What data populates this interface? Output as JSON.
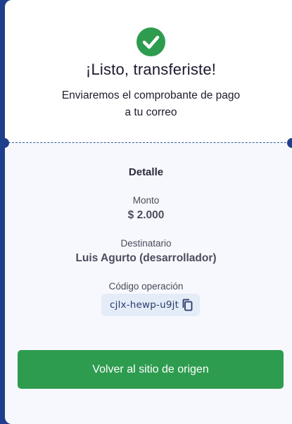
{
  "status": {
    "icon": "check-circle-icon",
    "title": "¡Listo, transferiste!",
    "subtitle_line1": "Enviaremos el comprobante de pago",
    "subtitle_line2": "a tu correo"
  },
  "details": {
    "section_title": "Detalle",
    "amount_label": "Monto",
    "amount_value": "$ 2.000",
    "recipient_label": "Destinatario",
    "recipient_value": "Luis Agurto (desarrollador)",
    "operation_code_label": "Código operación",
    "operation_code_value": "cjlx-hewp-u9jt",
    "copy_icon": "copy-icon"
  },
  "actions": {
    "return_button_label": "Volver al sitio de origen"
  },
  "colors": {
    "success": "#2e9c4f",
    "page_background": "#1f3f8c",
    "chip_background": "#e4ecf8"
  }
}
